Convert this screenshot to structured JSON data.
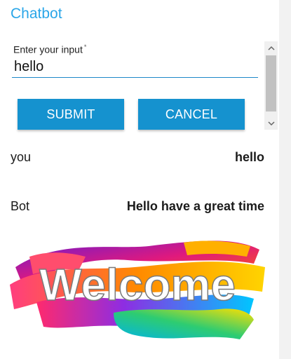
{
  "app": {
    "title": "Chatbot"
  },
  "form": {
    "label": "Enter your input",
    "required_mark": "*",
    "value": "hello",
    "submit_label": "SUBMIT",
    "cancel_label": "CANCEL"
  },
  "conversation": [
    {
      "speaker": "you",
      "text": "hello"
    },
    {
      "speaker": "Bot",
      "text": "Hello have a great time"
    }
  ],
  "banner": {
    "text": "Welcome"
  },
  "colors": {
    "title": "#2aa6e8",
    "button": "#1592cf",
    "input_underline": "#1e88c8"
  },
  "icons": {
    "scroll_up": "chevron-up-icon",
    "scroll_down": "chevron-down-icon"
  }
}
